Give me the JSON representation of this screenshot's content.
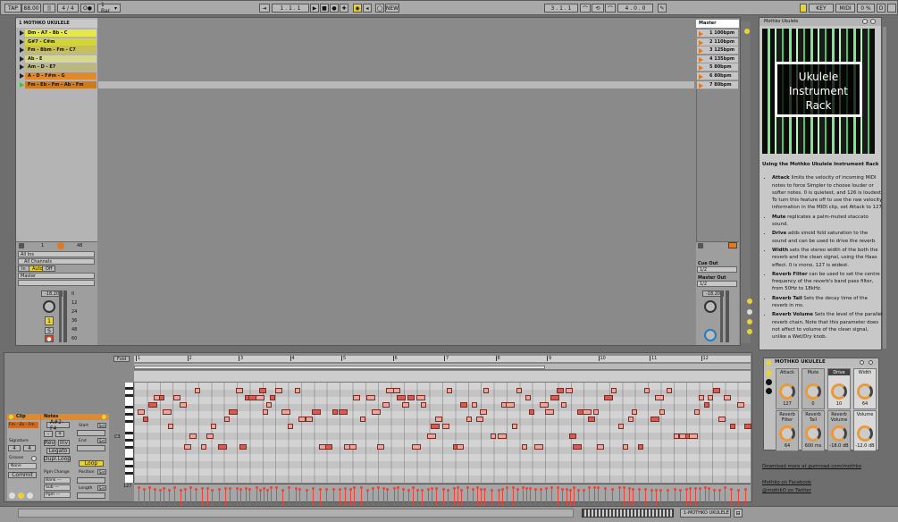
{
  "transport": {
    "tap": "TAP",
    "tempo": "88.00",
    "time_sig": "4 / 4",
    "metro": "O●",
    "quantize": "1 Bar",
    "arrangement_pos": "1 . 1 . 1",
    "new": "NEW",
    "loop_start": "3 . 1 . 1",
    "loop_len": "4 . 0 . 0",
    "key": "KEY",
    "midi": "MIDI",
    "cpu": "0 %",
    "d": "D"
  },
  "track": {
    "title": "1 MOTHKO UKULELE",
    "clips": [
      {
        "label": "Dm - A7 - Bb - C",
        "color": "#e6e84a"
      },
      {
        "label": "G#7 - C#m",
        "color": "#d3d33a"
      },
      {
        "label": "Fm - Bbm - Fm - C7",
        "color": "#c7c05a"
      },
      {
        "label": "Ab - E",
        "color": "#d6d890"
      },
      {
        "label": "Am - D - E7",
        "color": "#bcb780"
      },
      {
        "label": "A - D - F#m - G",
        "color": "#e08a2c"
      },
      {
        "label": "Fm - Eb - Fm - Ab - Fm",
        "color": "#d07a1e"
      }
    ],
    "io": {
      "num": "1",
      "num2": "48",
      "input": "All Ins",
      "channel": "All Channels",
      "in": "In",
      "auto": "Auto",
      "off": "Off",
      "output": "Master",
      "vol": "-18.20",
      "arm": "1",
      "solo": "S",
      "ticks": [
        "0",
        "12",
        "24",
        "36",
        "48",
        "60"
      ]
    }
  },
  "master": {
    "title": "Master",
    "scenes": [
      "1 100bpm",
      "2 110bpm",
      "3 125bpm",
      "4 135bpm",
      "5 80bpm",
      "6 80bpm",
      "7 80bpm"
    ],
    "cue_out": "Cue Out",
    "cue_val": "1/2",
    "master_out": "Master Out",
    "master_val": "1/2",
    "vol": "-18.20"
  },
  "clip_view": {
    "clip_label": "Clip",
    "notes_label": "Notes",
    "clip_name": "Fm - Eb - Fm",
    "signature": "Signature",
    "sig_num": "4",
    "sig_den": "4",
    "groove": "Groove",
    "groove_val": "None",
    "commit": "Commit",
    "note_range": "A#2-F4",
    "pitch_up": "Rev",
    "inv": "Inv",
    "legato": "Legato",
    "dupl_loop": "Dupl.Loop",
    "pgm_change": "Pgm Change",
    "bank": "Bank ---",
    "sub": "Sub ---",
    "pgm": "Pgm ---",
    "start": "Start",
    "set": "Set",
    "end": "End",
    "loop": "Loop",
    "position": "Position",
    "length": "Length",
    "fold": "Fold",
    "c3": "C3",
    "bar_ticks": [
      "1",
      "2",
      "3",
      "4",
      "5",
      "6",
      "7",
      "8",
      "9",
      "10",
      "11",
      "12"
    ],
    "vel_top": "127"
  },
  "info": {
    "title": "Mothko Ukulele",
    "rack_img": "Ukulele Instrument Rack",
    "heading": "Using the Mothko Ukulele Instrument Rack",
    "items": [
      {
        "key": "Attack",
        "text": " limits the velocity of incoming MIDI notes to force Simpler to choose louder or softer notes. 0 is quietest, and 126 is loudest. To turn this feature off to use the raw velocity information in the MIDI clip, set Attack to 127."
      },
      {
        "key": "Mute",
        "text": " replicates a palm-muted staccato sound."
      },
      {
        "key": "Drive",
        "text": " adds sinoid fold saturation to the sound and can be used to drive the reverb."
      },
      {
        "key": "Width",
        "text": " sets the stereo width of the both the reverb and the clean signal, using the Haas effect. 0 is mono, 127 is widest."
      },
      {
        "key": "Reverb Filter",
        "text": " can be used to set the centre frequency of the reverb's band pass filter, from 50Hz to 18kHz."
      },
      {
        "key": "Reverb Tail",
        "text": " Sets the decay time of the reverb in ms."
      },
      {
        "key": "Reverb Volume",
        "text": " Sets the level of the parallel reverb chain. Note that this parameter does not affect to volume of the clean signal, unlike a Wet/Dry knob."
      }
    ],
    "download": "Download more at gumroad.com/mothko",
    "facebook": "Mothko on Facebook",
    "twitter": "@mothkO on Twitter"
  },
  "device": {
    "title": "MOTHKO UKULELE",
    "macros": [
      {
        "label": "Attack",
        "value": "127"
      },
      {
        "label": "Mute",
        "value": "0"
      },
      {
        "label": "Drive",
        "value": "10"
      },
      {
        "label": "Width",
        "value": "64"
      },
      {
        "label": "Reverb Filter",
        "value": "64"
      },
      {
        "label": "Reverb Tail",
        "value": "600 ms"
      },
      {
        "label": "Reverb Volume",
        "value": "-18.0 dB"
      },
      {
        "label": "Volume",
        "value": "-12.0 dB"
      }
    ]
  },
  "status": {
    "track_name": "1-MOTHKO UKULELE"
  }
}
